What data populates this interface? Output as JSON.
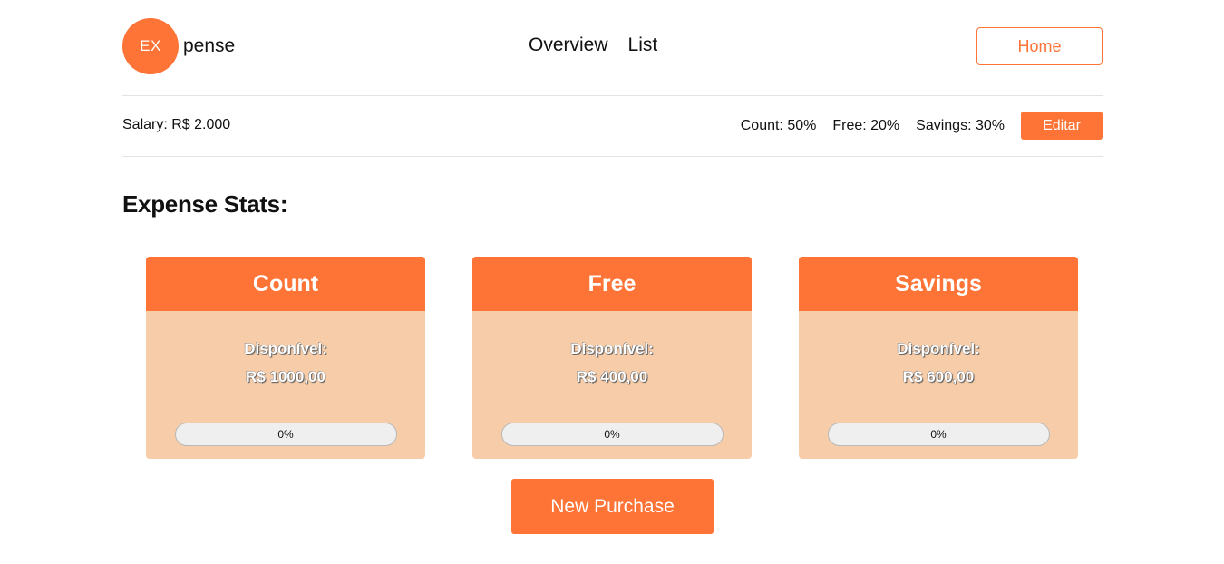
{
  "header": {
    "logo_badge": "EX",
    "logo_text": "pense",
    "nav": [
      "Overview",
      "List"
    ],
    "home_label": "Home"
  },
  "budget": {
    "salary": "Salary: R$ 2.000",
    "ratios": [
      "Count: 50%",
      "Free: 20%",
      "Savings: 30%"
    ],
    "edit_label": "Editar"
  },
  "stats": {
    "title": "Expense Stats:",
    "cards": [
      {
        "name": "Count",
        "label": "Disponível:",
        "value": "R$ 1000,00",
        "progress_text": "0%",
        "progress": 0
      },
      {
        "name": "Free",
        "label": "Disponível:",
        "value": "R$ 400,00",
        "progress_text": "0%",
        "progress": 0
      },
      {
        "name": "Savings",
        "label": "Disponível:",
        "value": "R$ 600,00",
        "progress_text": "0%",
        "progress": 0
      }
    ]
  },
  "actions": {
    "new_purchase_label": "New Purchase"
  },
  "colors": {
    "accent": "#fe7336",
    "card_bg": "#f7cda9",
    "progress_bg": "#efefef"
  }
}
